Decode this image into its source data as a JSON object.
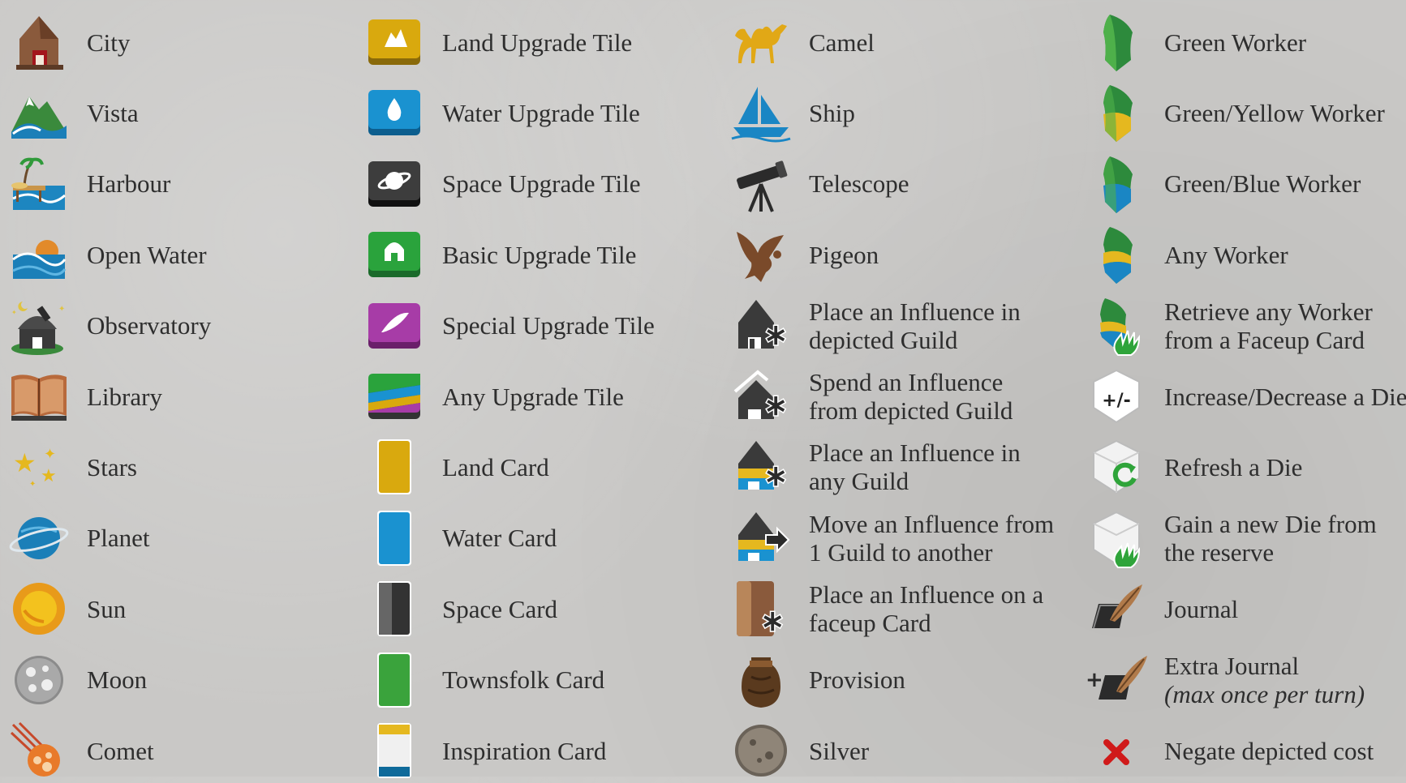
{
  "columns": [
    {
      "items": [
        {
          "icon": "city-icon",
          "label": "City"
        },
        {
          "icon": "vista-icon",
          "label": "Vista"
        },
        {
          "icon": "harbour-icon",
          "label": "Harbour"
        },
        {
          "icon": "open-water-icon",
          "label": "Open Water"
        },
        {
          "icon": "observatory-icon",
          "label": "Observatory"
        },
        {
          "icon": "library-icon",
          "label": "Library"
        },
        {
          "icon": "stars-icon",
          "label": "Stars"
        },
        {
          "icon": "planet-icon",
          "label": "Planet"
        },
        {
          "icon": "sun-icon",
          "label": "Sun"
        },
        {
          "icon": "moon-icon",
          "label": "Moon"
        },
        {
          "icon": "comet-icon",
          "label": "Comet"
        }
      ]
    },
    {
      "items": [
        {
          "icon": "land-upgrade-tile-icon",
          "label": "Land Upgrade Tile"
        },
        {
          "icon": "water-upgrade-tile-icon",
          "label": "Water Upgrade Tile"
        },
        {
          "icon": "space-upgrade-tile-icon",
          "label": "Space Upgrade Tile"
        },
        {
          "icon": "basic-upgrade-tile-icon",
          "label": "Basic Upgrade Tile"
        },
        {
          "icon": "special-upgrade-tile-icon",
          "label": "Special Upgrade Tile"
        },
        {
          "icon": "any-upgrade-tile-icon",
          "label": "Any Upgrade Tile"
        },
        {
          "icon": "land-card-icon",
          "label": "Land Card"
        },
        {
          "icon": "water-card-icon",
          "label": "Water Card"
        },
        {
          "icon": "space-card-icon",
          "label": "Space Card"
        },
        {
          "icon": "townsfolk-card-icon",
          "label": "Townsfolk Card"
        },
        {
          "icon": "inspiration-card-icon",
          "label": "Inspiration Card"
        }
      ]
    },
    {
      "items": [
        {
          "icon": "camel-icon",
          "label": "Camel"
        },
        {
          "icon": "ship-icon",
          "label": "Ship"
        },
        {
          "icon": "telescope-icon",
          "label": "Telescope"
        },
        {
          "icon": "pigeon-icon",
          "label": "Pigeon"
        },
        {
          "icon": "place-influence-depicted-guild-icon",
          "label": "Place an Influence in",
          "label2": "depicted Guild"
        },
        {
          "icon": "spend-influence-icon",
          "label": "Spend an Influence",
          "label2": "from depicted Guild"
        },
        {
          "icon": "place-influence-any-guild-icon",
          "label": "Place an Influence in",
          "label2": "any Guild"
        },
        {
          "icon": "move-influence-icon",
          "label": "Move an Influence from",
          "label2": "1 Guild to another"
        },
        {
          "icon": "influence-faceup-card-icon",
          "label": "Place an Influence on a",
          "label2": "faceup Card"
        },
        {
          "icon": "provision-icon",
          "label": "Provision"
        },
        {
          "icon": "silver-icon",
          "label": "Silver"
        }
      ]
    },
    {
      "items": [
        {
          "icon": "green-worker-icon",
          "label": "Green Worker"
        },
        {
          "icon": "green-yellow-worker-icon",
          "label": "Green/Yellow Worker"
        },
        {
          "icon": "green-blue-worker-icon",
          "label": "Green/Blue Worker"
        },
        {
          "icon": "any-worker-icon",
          "label": "Any Worker"
        },
        {
          "icon": "retrieve-worker-icon",
          "label": "Retrieve any Worker",
          "label2": "from a Faceup Card"
        },
        {
          "icon": "die-plus-minus-icon",
          "label": "Increase/Decrease a Die"
        },
        {
          "icon": "refresh-die-icon",
          "label": "Refresh a Die"
        },
        {
          "icon": "new-die-icon",
          "label": "Gain a new Die from",
          "label2": "the reserve"
        },
        {
          "icon": "journal-icon",
          "label": "Journal"
        },
        {
          "icon": "extra-journal-icon",
          "label": "Extra Journal",
          "label2": "(max once per turn)",
          "label2_italic": true
        },
        {
          "icon": "negate-cost-icon",
          "label": "Negate depicted cost"
        }
      ]
    }
  ]
}
